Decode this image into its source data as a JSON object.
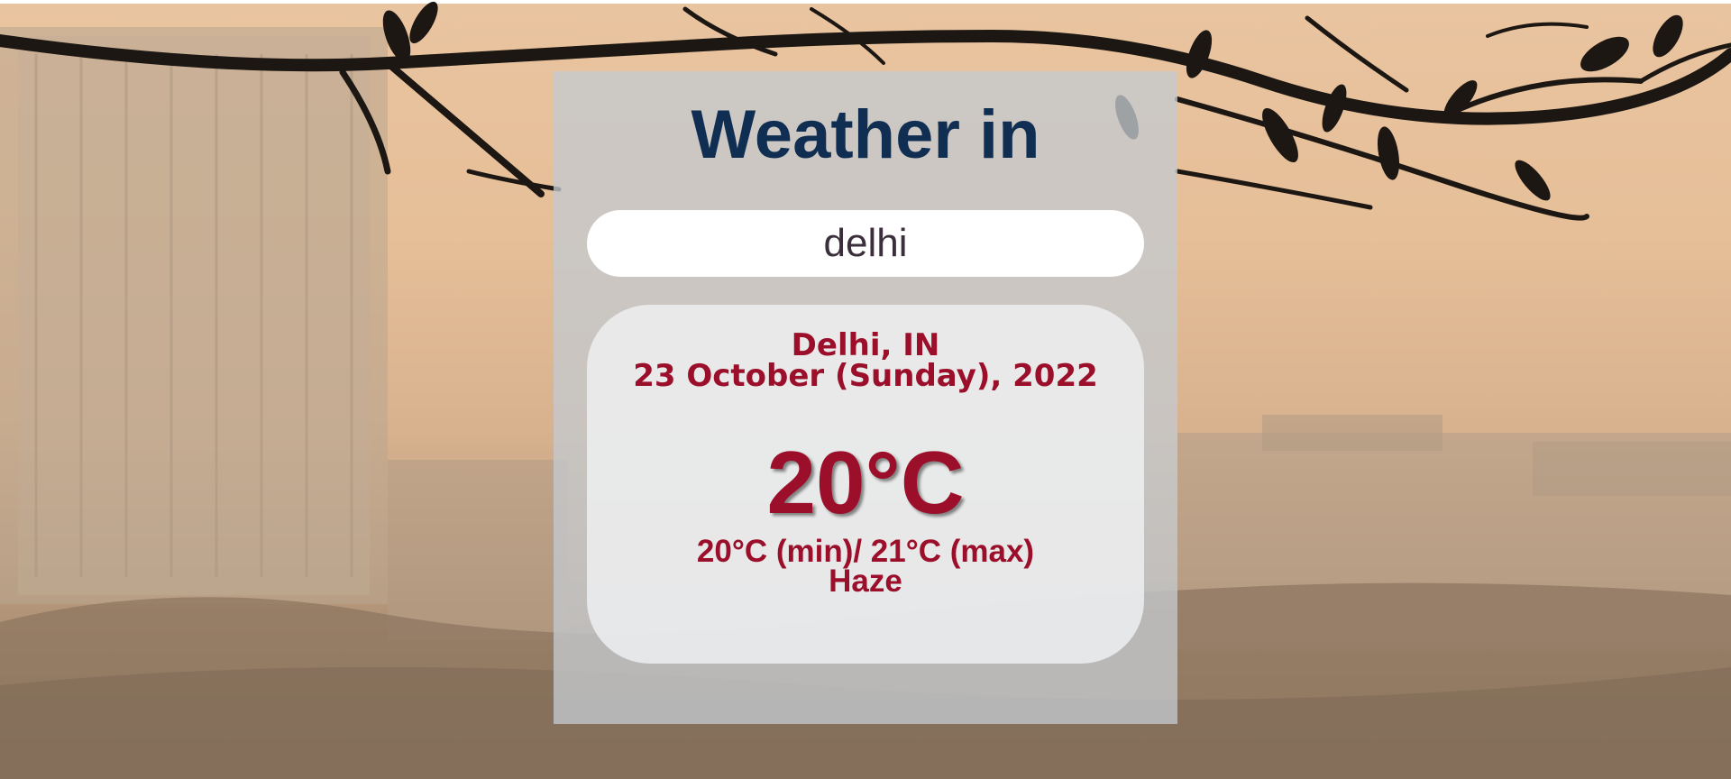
{
  "page": {
    "heading": "Weather in"
  },
  "search": {
    "value": "delhi"
  },
  "weather": {
    "location": "Delhi, IN",
    "date": "23 October (Sunday), 2022",
    "temperature": "20°C",
    "min_max": "20°C (min)/ 21°C (max)",
    "condition": "Haze"
  },
  "colors": {
    "heading": "#0f2e52",
    "accent": "#9b0f2b",
    "panel": "#c4c9ce",
    "card": "#eeeff0"
  }
}
